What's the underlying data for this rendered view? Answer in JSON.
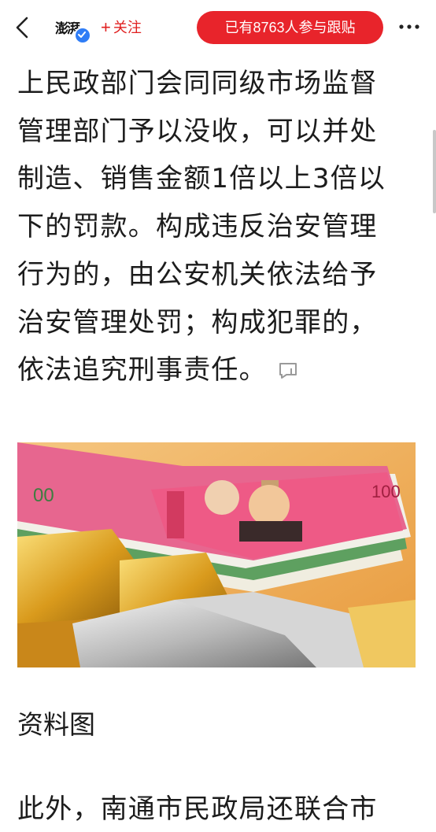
{
  "header": {
    "logo_text": "澎湃",
    "follow_label": "关注",
    "join_label": "已有8763人参与跟贴"
  },
  "article": {
    "lines": [
      "上民政部门会同同级市场监督",
      "管理部门予以没收，可以并处",
      "制造、销售金额1倍以上3倍以",
      "下的罚款。构成违反治安管理",
      "行为的，由公安机关依法给予",
      "治安管理处罚；构成犯罪的，",
      "依法追究刑事责任。"
    ],
    "caption": "资料图",
    "next_line": "此外，南通市民政局还联合市"
  },
  "colors": {
    "accent": "#e8242b",
    "verified": "#2f7df6"
  },
  "icons": {
    "back": "chevron-left-icon",
    "more": "more-dots-icon",
    "comment": "comment-bubble-icon",
    "verified": "verified-check-icon"
  }
}
